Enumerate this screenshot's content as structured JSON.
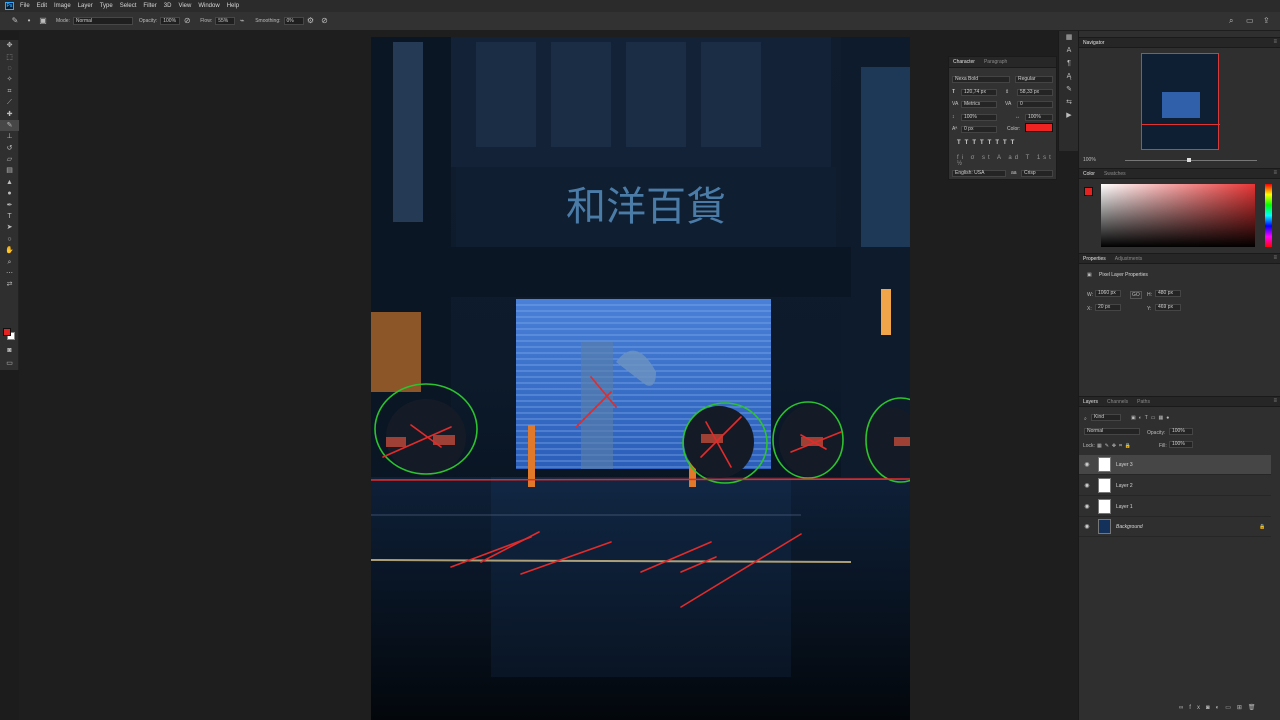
{
  "menu": [
    "File",
    "Edit",
    "Image",
    "Layer",
    "Type",
    "Select",
    "Filter",
    "3D",
    "View",
    "Window",
    "Help"
  ],
  "options": {
    "mode_label": "Mode:",
    "mode_value": "Normal",
    "opacity_label": "Opacity:",
    "opacity_value": "100%",
    "flow_label": "Flow:",
    "flow_value": "55%",
    "smoothing_label": "Smoothing:",
    "smoothing_value": "0%"
  },
  "character": {
    "tabs": [
      "Character",
      "Paragraph"
    ],
    "font_family": "Nexa Bold",
    "font_style": "Regular",
    "size": "120,74 px",
    "leading": "58,33 px",
    "kerning": "Metrics",
    "tracking": "0",
    "vscale": "100%",
    "hscale": "100%",
    "baseline": "0 px",
    "color_label": "Color:",
    "language": "English: USA",
    "aa": "Crisp",
    "text_color": "#f02323"
  },
  "navigator": {
    "title": "Navigator",
    "zoom": "100%"
  },
  "color": {
    "tabs": [
      "Color",
      "Swatches"
    ],
    "fg": "#e32222",
    "bg": "#ffffff"
  },
  "properties": {
    "tabs": [
      "Properties",
      "Adjustments"
    ],
    "type": "Pixel Layer Properties",
    "w_label": "W:",
    "w": "1060 px",
    "h_label": "H:",
    "h": "480 px",
    "x_label": "X:",
    "x": "20 px",
    "y_label": "Y:",
    "y": "469 px",
    "link": "GO"
  },
  "layers": {
    "tabs": [
      "Layers",
      "Channels",
      "Paths"
    ],
    "filter_kind": "Kind",
    "blend": "Normal",
    "opacity_label": "Opacity:",
    "opacity": "100%",
    "lock_label": "Lock:",
    "fill_label": "Fill:",
    "fill": "100%",
    "items": [
      {
        "name": "Layer 3",
        "selected": true
      },
      {
        "name": "Layer 2",
        "selected": false
      },
      {
        "name": "Layer 1",
        "selected": false
      },
      {
        "name": "Background",
        "selected": false
      }
    ]
  },
  "canvas": {
    "sign_text": "和洋百貨"
  },
  "colors": {
    "accent_red": "#e32222",
    "annotation_green": "#22c524",
    "ui_bg": "#1e1e1e"
  }
}
